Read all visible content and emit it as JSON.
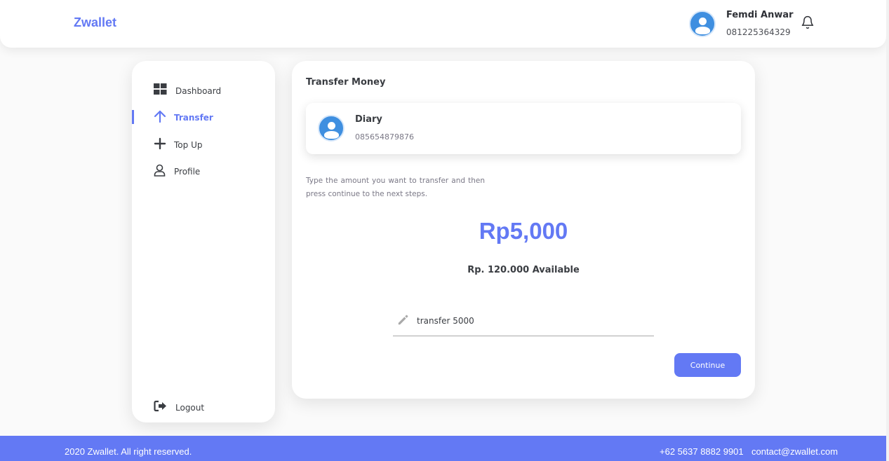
{
  "colors": {
    "accent": "#6379f4",
    "avatar": "#3f8fe0",
    "text_dark": "#3a3d42",
    "text_muted": "#7a7886"
  },
  "header": {
    "brand": "Zwallet",
    "user": {
      "name": "Femdi Anwar",
      "phone": "081225364329",
      "avatar_icon": "user-avatar-icon"
    },
    "notification_icon": "bell-icon"
  },
  "sidebar": {
    "items": [
      {
        "label": "Dashboard",
        "icon": "grid-icon",
        "active": false
      },
      {
        "label": "Transfer",
        "icon": "arrow-up-icon",
        "active": true
      },
      {
        "label": "Top Up",
        "icon": "plus-icon",
        "active": false
      },
      {
        "label": "Profile",
        "icon": "user-icon",
        "active": false
      }
    ],
    "logout": {
      "label": "Logout",
      "icon": "logout-icon"
    }
  },
  "transfer": {
    "title": "Transfer Money",
    "recipient": {
      "name": "Diary",
      "phone": "085654879876"
    },
    "instructions": "Type the amount you want to transfer and then press continue to the next steps.",
    "amount": "Rp5,000",
    "available": "Rp. 120.000 Available",
    "note": {
      "value": "transfer 5000",
      "icon": "pencil-icon"
    },
    "continue_label": "Continue"
  },
  "footer": {
    "copyright": "2020 Zwallet. All right reserved.",
    "phone": "+62 5637 8882 9901",
    "email": "contact@zwallet.com"
  }
}
